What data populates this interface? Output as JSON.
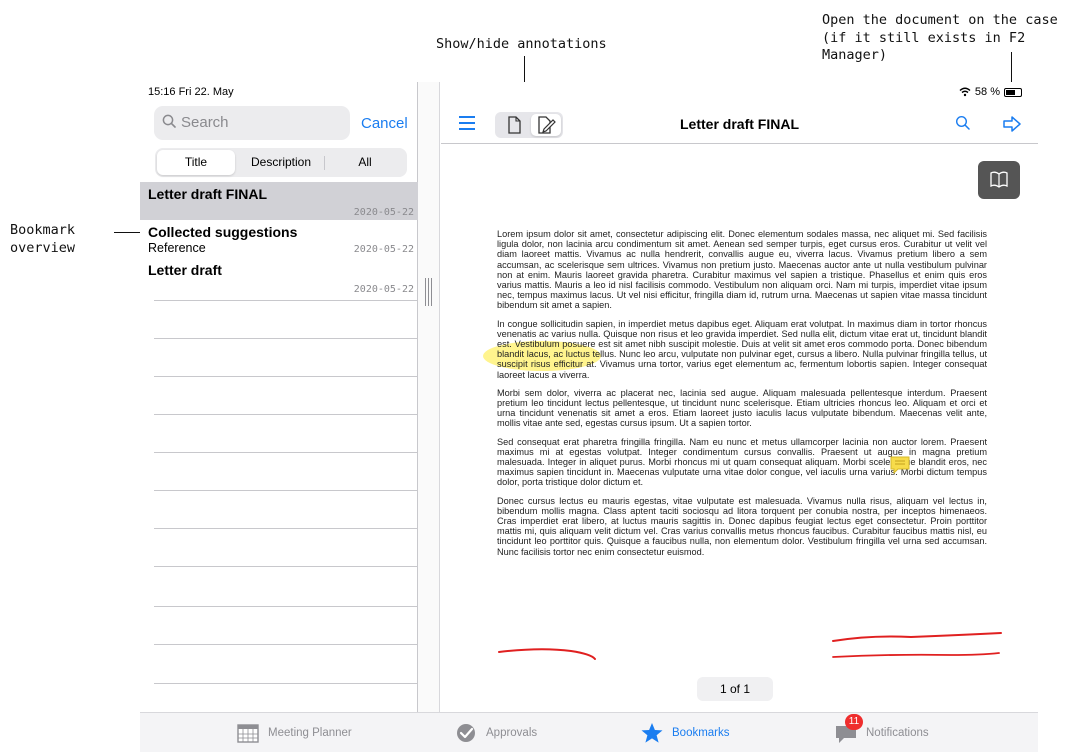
{
  "callouts": {
    "annotations": "Show/hide annotations",
    "open_line1": "Open the document on the case",
    "open_line2": "(if it still exists in F2 Manager)",
    "bookmark_line1": "Bookmark",
    "bookmark_line2": "overview"
  },
  "status_bar": {
    "time_date": "15:16  Fri 22. May",
    "battery": "58 %"
  },
  "sidebar": {
    "search_placeholder": "Search",
    "cancel_label": "Cancel",
    "segments": [
      "Title",
      "Description",
      "All"
    ],
    "active_segment": "Title",
    "bookmarks": [
      {
        "title": "Letter draft FINAL",
        "description": "",
        "date": "2020-05-22",
        "selected": true
      },
      {
        "title": "Collected suggestions",
        "description": "Reference",
        "date": "2020-05-22",
        "selected": false
      },
      {
        "title": "Letter draft",
        "description": "",
        "date": "2020-05-22",
        "selected": false
      }
    ]
  },
  "document": {
    "title": "Letter draft FINAL",
    "page_indicator": "1 of 1",
    "paragraphs": [
      "Lorem ipsum dolor sit amet, consectetur adipiscing elit. Donec elementum sodales massa, nec aliquet mi. Sed facilisis ligula dolor, non lacinia arcu condimentum sit amet. Aenean sed semper turpis, eget cursus eros. Curabitur ut velit vel diam laoreet mattis. Vivamus ac nulla hendrerit, convallis augue eu, viverra lacus. Vivamus pretium libero a sem accumsan, ac scelerisque sem ultrices. Vivamus non pretium justo. Maecenas auctor ante ut nulla vestibulum pulvinar non at enim. Mauris laoreet gravida pharetra. Curabitur maximus vel sapien a tristique. Phasellus et enim quis eros varius mattis. Mauris a leo id nisl facilisis commodo. Vestibulum non aliquam orci. Nam mi turpis, imperdiet vitae ipsum nec, tempus maximus lacus. Ut vel nisi efficitur, fringilla diam id, rutrum urna. Maecenas ut sapien vitae massa tincidunt bibendum sit amet a sapien.",
      "In congue sollicitudin sapien, in imperdiet metus dapibus eget. Aliquam erat volutpat. In maximus diam in tortor rhoncus venenatis ac varius nulla. Quisque non risus et leo gravida imperdiet. Sed nulla elit, dictum vitae erat ut, tincidunt blandit est. Vestibulum posuere est sit amet nibh suscipit molestie. Duis at velit sit amet eros commodo porta. Donec bibendum blandit lacus, ac luctus tellus. Nunc leo arcu, vulputate non pulvinar eget, cursus a libero. Nulla pulvinar fringilla tellus, ut suscipit risus efficitur at. Vivamus urna tortor, varius eget elementum ac, fermentum lobortis sapien. Integer consequat laoreet lacus a viverra.",
      "Morbi sem dolor, viverra ac placerat nec, lacinia sed augue. Aliquam malesuada pellentesque interdum. Praesent pretium leo tincidunt lectus pellentesque, ut tincidunt nunc scelerisque. Etiam ultricies rhoncus leo. Aliquam et orci et urna tincidunt venenatis sit amet a eros. Etiam laoreet justo iaculis lacus vulputate bibendum. Maecenas velit ante, mollis vitae ante sed, egestas cursus ipsum. Ut a sapien tortor.",
      "Sed consequat erat pharetra fringilla fringilla. Nam eu nunc et metus ullamcorper lacinia non auctor lorem. Praesent maximus mi at egestas volutpat. Integer condimentum cursus convallis. Praesent ut augue in magna pretium malesuada. Integer in aliquet purus. Morbi rhoncus mi ut quam consequat aliquam. Morbi scelerisque blandit eros, nec maximus sapien tincidunt in. Maecenas vulputate urna vitae dolor congue, vel iaculis urna varius. Morbi dictum tempus dolor, porta tristique dolor dictum et.",
      "Donec cursus lectus eu mauris egestas, vitae vulputate est malesuada. Vivamus nulla risus, aliquam vel lectus in, bibendum mollis magna. Class aptent taciti sociosqu ad litora torquent per conubia nostra, per inceptos himenaeos. Cras imperdiet erat libero, at luctus mauris sagittis in. Donec dapibus feugiat lectus eget consectetur. Proin porttitor mattis mi, quis aliquam velit dictum vel. Cras varius convallis metus rhoncus faucibus. Curabitur faucibus mattis nisl, eu tincidunt leo porttitor quis. Quisque a faucibus nulla, non elementum dolor. Vestibulum fringilla vel urna sed accumsan. Nunc facilisis tortor nec enim consectetur euismod."
    ]
  },
  "tabbar": {
    "tabs": [
      {
        "label": "Meeting Planner",
        "icon": "calendar-icon",
        "active": false
      },
      {
        "label": "Approvals",
        "icon": "approval-check-icon",
        "active": false
      },
      {
        "label": "Bookmarks",
        "icon": "star-icon",
        "active": true
      },
      {
        "label": "Notifications",
        "icon": "chat-bubble-icon",
        "active": false,
        "badge": "11"
      }
    ]
  },
  "colors": {
    "accent": "#1a7df0",
    "highlight": "#fff27a",
    "ink": "#e02020",
    "badge": "#ef2d2d"
  }
}
